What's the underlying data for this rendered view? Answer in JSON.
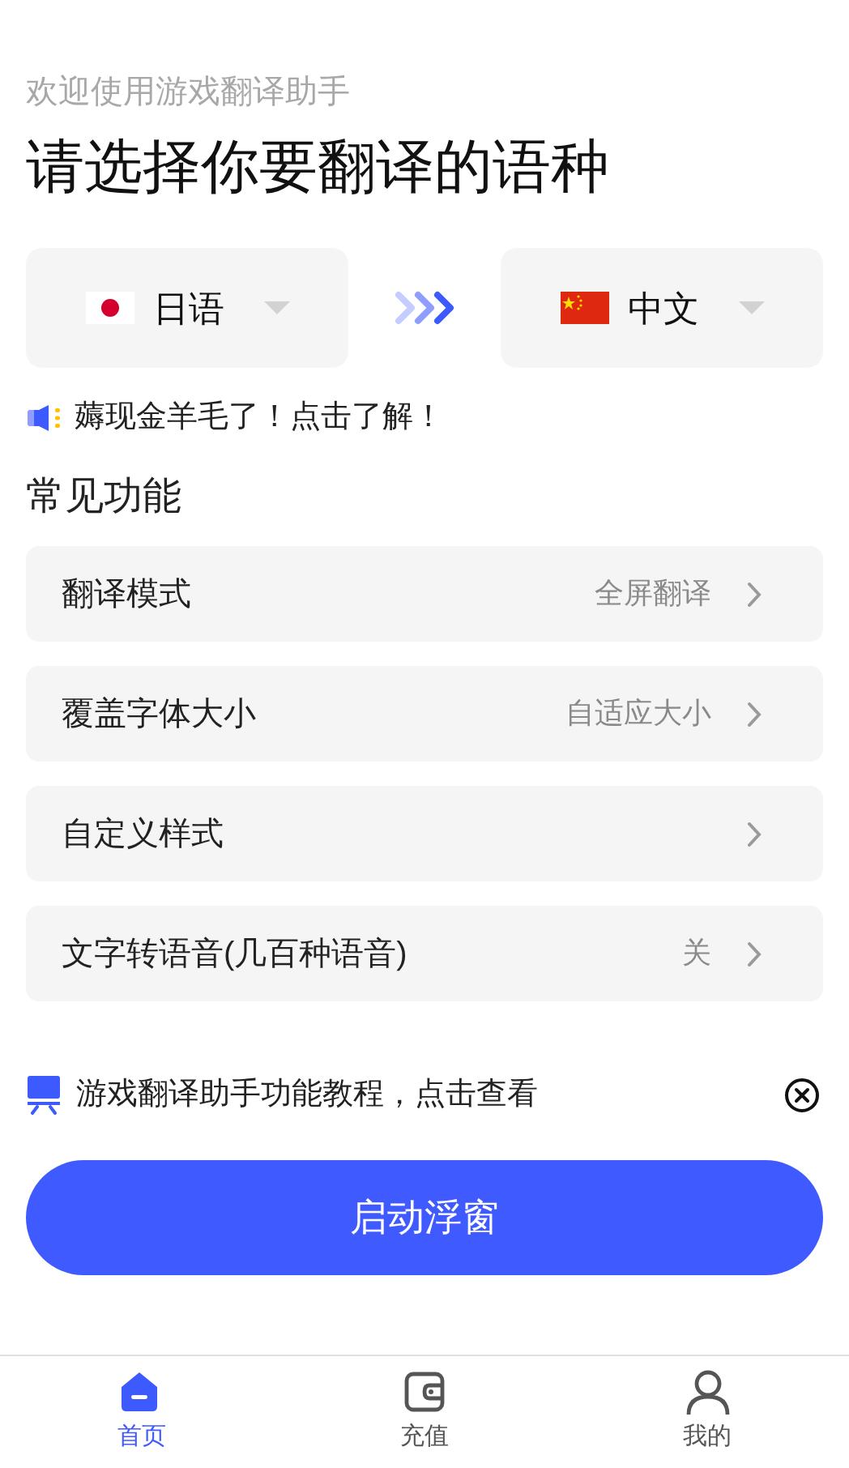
{
  "header": {
    "subtitle": "欢迎使用游戏翻译助手",
    "title": "请选择你要翻译的语种"
  },
  "languages": {
    "source": "日语",
    "target": "中文"
  },
  "promo": "薅现金羊毛了！点击了解！",
  "section_title": "常见功能",
  "settings": [
    {
      "label": "翻译模式",
      "value": "全屏翻译"
    },
    {
      "label": "覆盖字体大小",
      "value": "自适应大小"
    },
    {
      "label": "自定义样式"
    },
    {
      "label": "文字转语音(几百种语音)",
      "value": "关"
    }
  ],
  "tutorial": "游戏翻译助手功能教程，点击查看",
  "start_button": "启动浮窗",
  "tabs": [
    {
      "label": "首页",
      "selected": true
    },
    {
      "label": "充值",
      "selected": false
    },
    {
      "label": "我的",
      "selected": false
    }
  ]
}
